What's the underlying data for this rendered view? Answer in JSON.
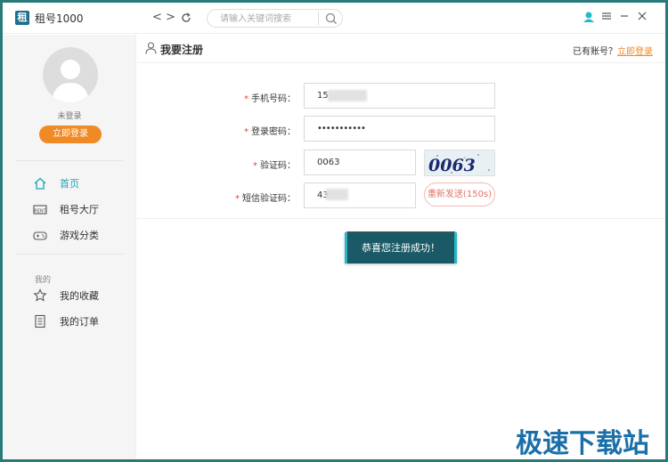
{
  "app": {
    "logo_char": "租",
    "title": "租号1000",
    "nav_back": "<",
    "nav_forward": ">",
    "nav_refresh": "↻",
    "search_placeholder": "请输入关键词搜索",
    "window_controls": [
      "user-icon",
      "menu-icon",
      "minimize-icon",
      "close-icon"
    ]
  },
  "sidebar": {
    "login_status": "未登录",
    "login_button": "立即登录",
    "items": [
      {
        "label": "首页",
        "icon": "home-icon",
        "active": true
      },
      {
        "label": "租号大厅",
        "icon": "rent-icon",
        "active": false
      },
      {
        "label": "游戏分类",
        "icon": "gamepad-icon",
        "active": false
      }
    ],
    "section_label": "我的",
    "my_items": [
      {
        "label": "我的收藏",
        "icon": "star-icon"
      },
      {
        "label": "我的订单",
        "icon": "order-icon"
      }
    ]
  },
  "main": {
    "page_title": "我要注册",
    "has_account_text": "已有账号？",
    "has_account_link": "立即登录",
    "form": {
      "phone_label": "手机号码：",
      "phone_value": "15",
      "password_label": "登录密码：",
      "password_value": "•••••••••••",
      "captcha_label": "验证码：",
      "captcha_value": "0063",
      "captcha_image_text": "0063",
      "sms_label": "短信验证码：",
      "sms_value": "43",
      "resend_button": "重新发送(150s)"
    },
    "toast": "恭喜您注册成功！"
  },
  "watermark": "极速下载站",
  "colors": {
    "accent": "#1aa3b8",
    "orange": "#f08a24",
    "required": "#e0453b",
    "toast_bg": "#1a5a66",
    "frame": "#2a7a7a"
  }
}
